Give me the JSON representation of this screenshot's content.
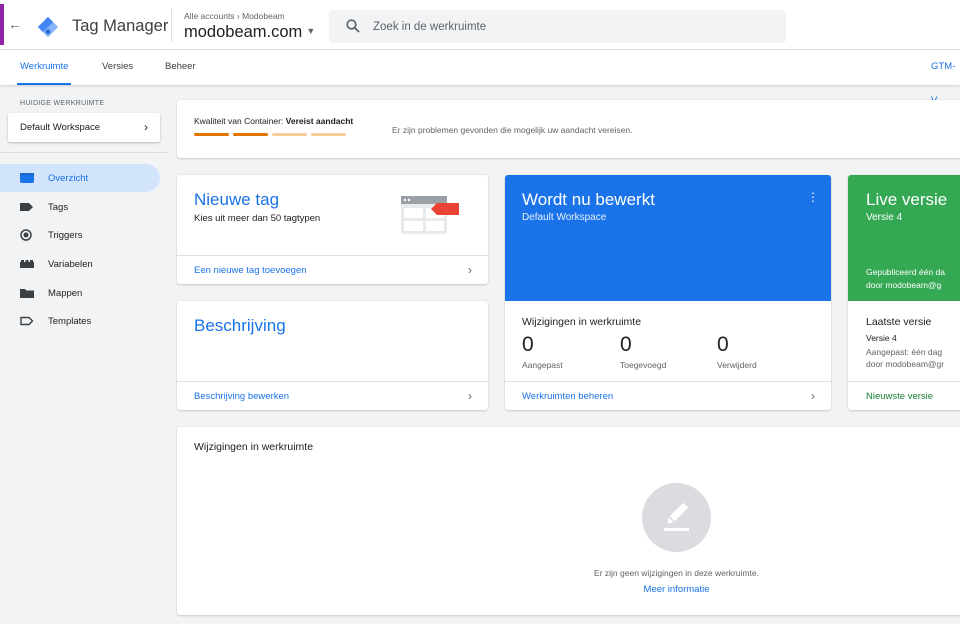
{
  "header": {
    "back_icon": "arrow-left-icon",
    "app_title": "Tag Manager",
    "breadcrumb": "Alle accounts › Modobeam",
    "container_name": "modobeam.com",
    "search_placeholder": "Zoek in de werkruimte",
    "colors": {
      "accent_strip": "#8e24aa",
      "brand_blue": "#1a73e8"
    }
  },
  "tabs": {
    "items": [
      {
        "label": "Werkruimte",
        "active": true
      },
      {
        "label": "Versies",
        "active": false
      },
      {
        "label": "Beheer",
        "active": false
      }
    ],
    "container_id": "GTM-V"
  },
  "sidebar": {
    "workspace_label": "HUIDIGE WERKRUIMTE",
    "workspace_name": "Default Workspace",
    "items": [
      {
        "label": "Overzicht",
        "icon": "overview-icon",
        "active": true
      },
      {
        "label": "Tags",
        "icon": "tag-icon",
        "active": false
      },
      {
        "label": "Triggers",
        "icon": "trigger-icon",
        "active": false
      },
      {
        "label": "Variabelen",
        "icon": "variables-icon",
        "active": false
      },
      {
        "label": "Mappen",
        "icon": "folder-icon",
        "active": false
      },
      {
        "label": "Templates",
        "icon": "template-icon",
        "active": false
      }
    ]
  },
  "quality": {
    "label": "Kwaliteit van Container:",
    "status": "Vereist aandacht",
    "message": "Er zijn problemen gevonden die mogelijk uw aandacht vereisen.",
    "bars_filled": 2,
    "bars_total": 4,
    "colors": {
      "filled": "#e37400",
      "empty": "#f5cf9a"
    }
  },
  "new_tag": {
    "title": "Nieuwe tag",
    "subtitle": "Kies uit meer dan 50 tagtypen",
    "link": "Een nieuwe tag toevoegen"
  },
  "description": {
    "title": "Beschrijving",
    "link": "Beschrijving bewerken"
  },
  "editing": {
    "title": "Wordt nu bewerkt",
    "workspace": "Default Workspace",
    "changes_title": "Wijzigingen in werkruimte",
    "stats": [
      {
        "value": "0",
        "label": "Aangepast"
      },
      {
        "value": "0",
        "label": "Toegevoegd"
      },
      {
        "value": "0",
        "label": "Verwijderd"
      }
    ],
    "link": "Werkruimten beheren",
    "color": "#1a73e8"
  },
  "live": {
    "title": "Live versie",
    "version": "Versie 4",
    "published_line1": "Gepubliceerd één da",
    "published_line2": "door modobeam@g",
    "latest_title": "Laatste versie",
    "latest_version": "Versie 4",
    "latest_meta1": "Aangepast: één dag",
    "latest_meta2": "door modobeam@gr",
    "link": "Nieuwste versie",
    "color": "#34a853"
  },
  "workspace_changes": {
    "title": "Wijzigingen in werkruimte",
    "empty_icon": "pencil-icon",
    "empty_text": "Er zijn geen wijzigingen in deze werkruimte.",
    "more_link": "Meer informatie"
  }
}
